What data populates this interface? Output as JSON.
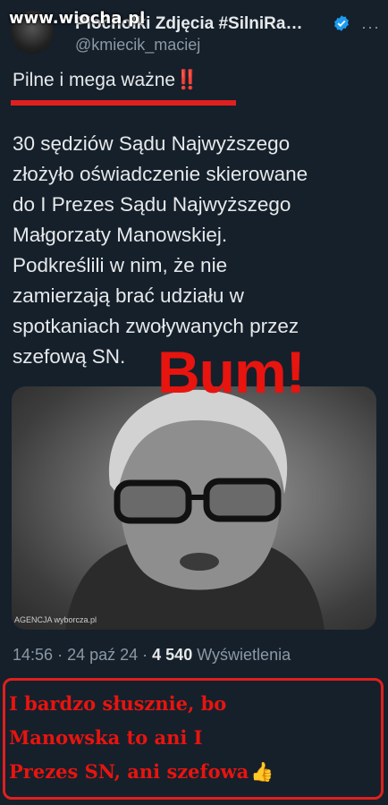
{
  "watermark": "www.wiocha.pl",
  "tweet": {
    "display_name": "Piochołki Zdjęcia #SilniRa…",
    "handle": "@kmiecik_maciej",
    "headline": "Pilne i mega ważne‼️",
    "body_lines": [
      "30 sędziów Sądu Najwyższego",
      "złożyło oświadczenie skierowane",
      "do I Prezes Sądu Najwyższego",
      "Małgorzaty Manowskiej.",
      "Podkreślili w nim, że nie",
      "zamierzają brać udziału w",
      "spotkaniach zwoływanych przez",
      "szefową SN."
    ],
    "photo_credit": "AGENCJA wyborcza.pl",
    "overlay_text": "Bum!",
    "time": "14:56",
    "date": "24 paź 24",
    "views_count": "4 540",
    "views_label": "Wyświetlenia"
  },
  "comment": {
    "lines": [
      "I bardzo słusznie, bo",
      "Manowska to ani I",
      "Prezes SN, ani szefowa"
    ]
  },
  "colors": {
    "background": "#15202b",
    "accent_red": "#e0201e",
    "muted": "#8b98a5"
  },
  "icons": [
    "verified-badge-icon",
    "more-options-icon",
    "thumbs-up-icon"
  ]
}
